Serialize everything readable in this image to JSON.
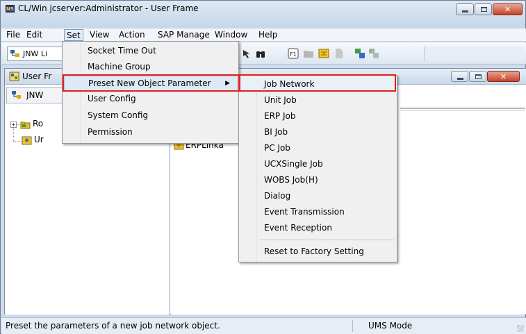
{
  "window": {
    "app_icon_text": "NS",
    "title": "CL/Win jcserver:Administrator - User Frame"
  },
  "menubar": {
    "items": [
      "File",
      "Edit",
      "Set",
      "View",
      "Action",
      "SAP Manage",
      "Window",
      "Help"
    ],
    "active": "Set"
  },
  "toolbar": {
    "combo_label": "JNW Li"
  },
  "child_window": {
    "title": "User Fr"
  },
  "left_pane": {
    "header_label": "JNW",
    "tree": [
      {
        "label": "Ro",
        "expander": "+"
      },
      {
        "label": "Ur"
      }
    ]
  },
  "right_pane": {
    "item_label": "ERPLinka"
  },
  "set_menu": {
    "items": [
      {
        "label": "Socket Time Out"
      },
      {
        "label": "Machine Group"
      },
      {
        "label": "Preset New Object Parameter",
        "has_submenu": true,
        "highlighted": true
      },
      {
        "label": "User Config"
      },
      {
        "label": "System Config"
      },
      {
        "label": "Permission"
      }
    ],
    "submenu_arrow": "▶"
  },
  "preset_submenu": {
    "items": [
      {
        "label": "Job Network",
        "highlighted": true
      },
      {
        "label": "Unit Job"
      },
      {
        "label": "ERP Job"
      },
      {
        "label": "BI Job"
      },
      {
        "label": "PC Job"
      },
      {
        "label": "UCXSingle Job"
      },
      {
        "label": "WOBS Job(H)"
      },
      {
        "label": "Dialog"
      },
      {
        "label": "Event Transmission"
      },
      {
        "label": "Event Reception"
      }
    ],
    "footer_item": "Reset to Factory Setting"
  },
  "statusbar": {
    "message": "Preset the parameters of a new job network object.",
    "mode": "UMS Mode"
  },
  "colors": {
    "highlight_border": "#e02020",
    "menu_background": "#f0f0f0",
    "titlebar": "#c6d6e8"
  }
}
